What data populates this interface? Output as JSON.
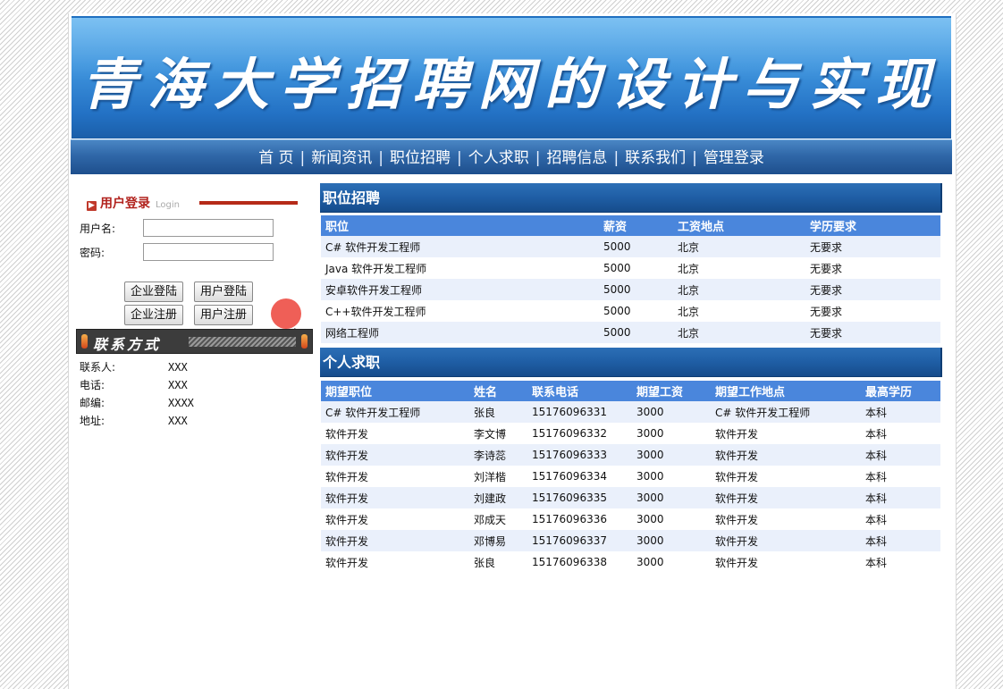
{
  "header": {
    "title": "青海大学招聘网的设计与实现"
  },
  "nav": [
    "首 页",
    "新闻资讯",
    "职位招聘",
    "个人求职",
    "招聘信息",
    "联系我们",
    "管理登录"
  ],
  "login": {
    "title": "用户登录",
    "subtitle": "Login",
    "username_label": "用户名:",
    "password_label": "密码:",
    "username_value": "",
    "password_value": "",
    "buttons": {
      "company_login": "企业登陆",
      "user_login": "用户登陆",
      "company_register": "企业注册",
      "user_register": "用户注册"
    }
  },
  "contact": {
    "title": "联系方式",
    "rows": [
      {
        "label": "联系人:",
        "value": "XXX"
      },
      {
        "label": "电话:",
        "value": "XXX"
      },
      {
        "label": "邮编:",
        "value": "XXXX"
      },
      {
        "label": "地址:",
        "value": "XXX"
      }
    ]
  },
  "jobs": {
    "title": "职位招聘",
    "columns": [
      "职位",
      "薪资",
      "工资地点",
      "学历要求"
    ],
    "rows": [
      [
        "C# 软件开发工程师",
        "5000",
        "北京",
        "无要求"
      ],
      [
        "Java 软件开发工程师",
        "5000",
        "北京",
        "无要求"
      ],
      [
        "安卓软件开发工程师",
        "5000",
        "北京",
        "无要求"
      ],
      [
        "C++软件开发工程师",
        "5000",
        "北京",
        "无要求"
      ],
      [
        "网络工程师",
        "5000",
        "北京",
        "无要求"
      ]
    ]
  },
  "seekers": {
    "title": "个人求职",
    "columns": [
      "期望职位",
      "姓名",
      "联系电话",
      "期望工资",
      "期望工作地点",
      "最高学历"
    ],
    "rows": [
      [
        "C# 软件开发工程师",
        "张良",
        "15176096331",
        "3000",
        "C# 软件开发工程师",
        "本科"
      ],
      [
        "软件开发",
        "李文博",
        "15176096332",
        "3000",
        "软件开发",
        "本科"
      ],
      [
        "软件开发",
        "李诗蕊",
        "15176096333",
        "3000",
        "软件开发",
        "本科"
      ],
      [
        "软件开发",
        "刘洋楷",
        "15176096334",
        "3000",
        "软件开发",
        "本科"
      ],
      [
        "软件开发",
        "刘建政",
        "15176096335",
        "3000",
        "软件开发",
        "本科"
      ],
      [
        "软件开发",
        "邓成天",
        "15176096336",
        "3000",
        "软件开发",
        "本科"
      ],
      [
        "软件开发",
        "邓博易",
        "15176096337",
        "3000",
        "软件开发",
        "本科"
      ],
      [
        "软件开发",
        "张良",
        "15176096338",
        "3000",
        "软件开发",
        "本科"
      ]
    ]
  }
}
